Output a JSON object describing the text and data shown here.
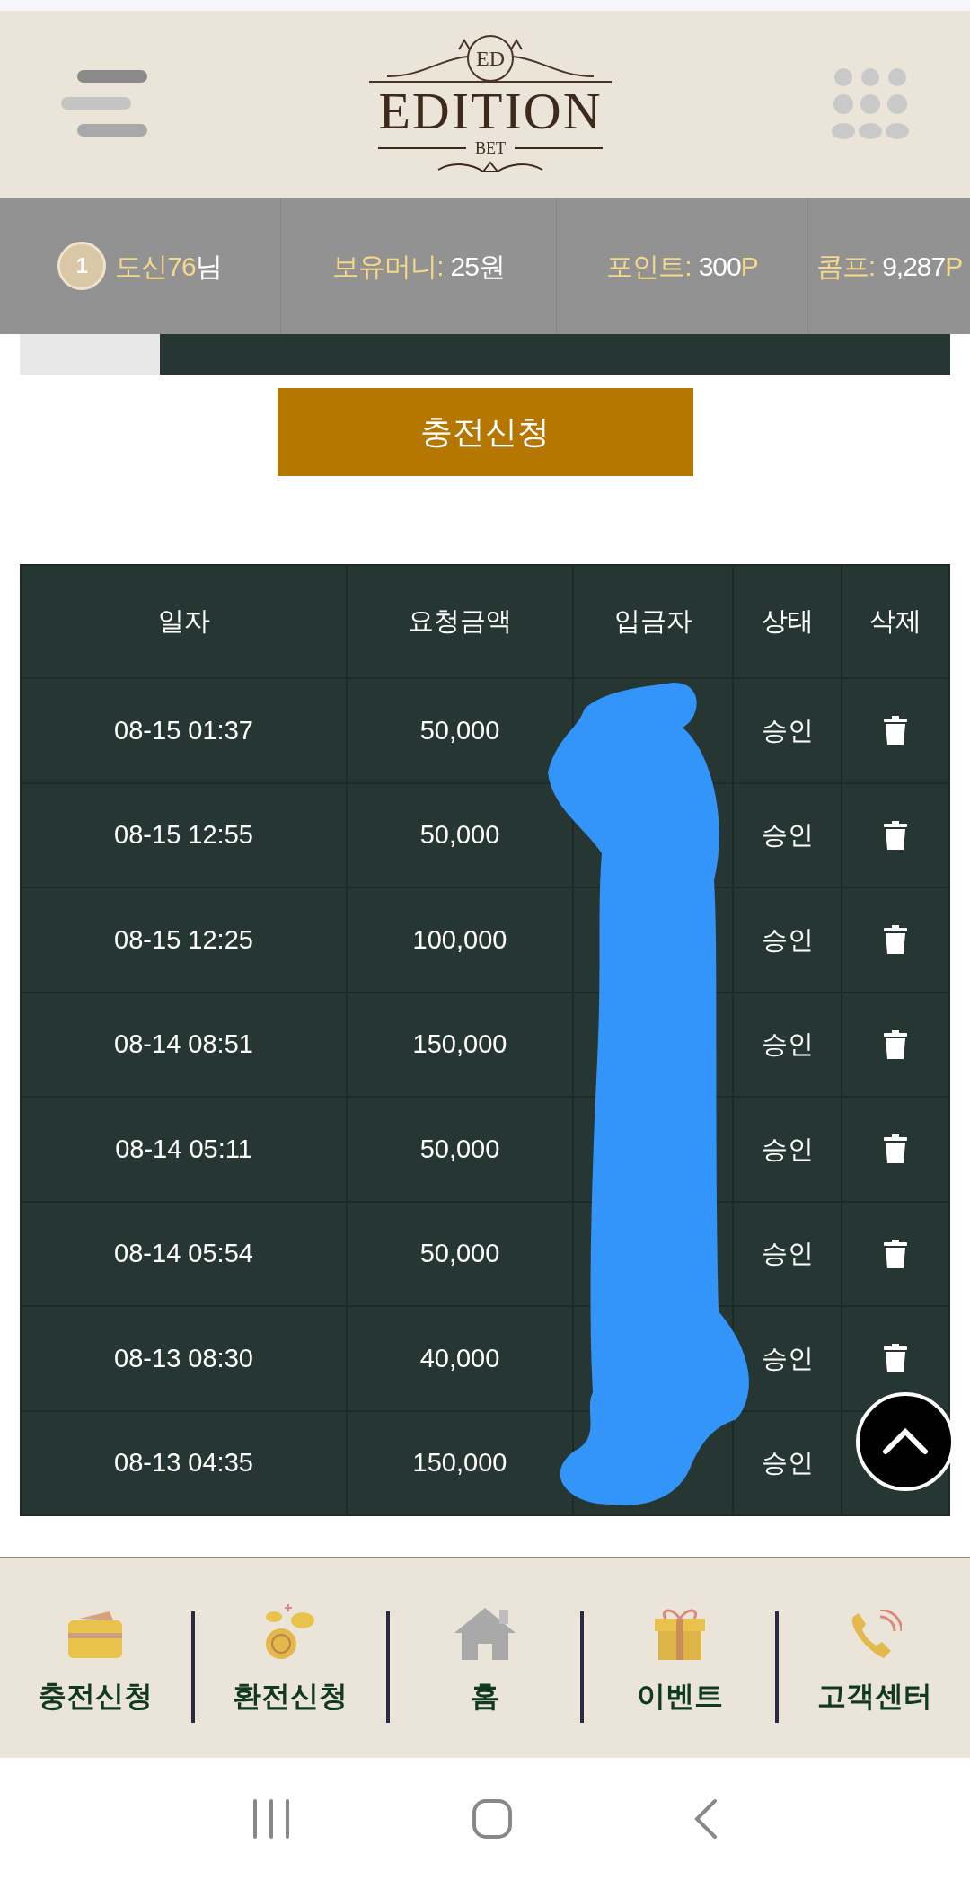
{
  "header": {
    "logo": {
      "title": "EDITION",
      "subtitle": "BET",
      "monogram": "ED"
    }
  },
  "user_bar": {
    "level": "1",
    "nickname": "도신76",
    "honorific": "님",
    "items": [
      {
        "label": "보유머니:",
        "value": "25원"
      },
      {
        "label": "포인트:",
        "value": "300",
        "unit": "P"
      },
      {
        "label": "콤프:",
        "value": "9,287",
        "unit": "P"
      }
    ]
  },
  "submit_button": "충전신청",
  "table": {
    "columns": [
      "일자",
      "요청금액",
      "입금자",
      "상태",
      "삭제"
    ],
    "rows": [
      {
        "date": "08-15 01:37",
        "amount": "50,000",
        "status": "승인"
      },
      {
        "date": "08-15 12:55",
        "amount": "50,000",
        "status": "승인"
      },
      {
        "date": "08-15 12:25",
        "amount": "100,000",
        "status": "승인"
      },
      {
        "date": "08-14 08:51",
        "amount": "150,000",
        "status": "승인"
      },
      {
        "date": "08-14 05:11",
        "amount": "50,000",
        "status": "승인"
      },
      {
        "date": "08-14 05:54",
        "amount": "50,000",
        "status": "승인"
      },
      {
        "date": "08-13 08:30",
        "amount": "40,000",
        "status": "승인"
      },
      {
        "date": "08-13 04:35",
        "amount": "150,000",
        "status": "승인"
      }
    ]
  },
  "bottom_nav": [
    {
      "label": "충전신청",
      "kind": "card"
    },
    {
      "label": "환전신청",
      "kind": "coins"
    },
    {
      "label": "홈",
      "kind": "home"
    },
    {
      "label": "이벤트",
      "kind": "gift"
    },
    {
      "label": "고객센터",
      "kind": "phone"
    }
  ]
}
